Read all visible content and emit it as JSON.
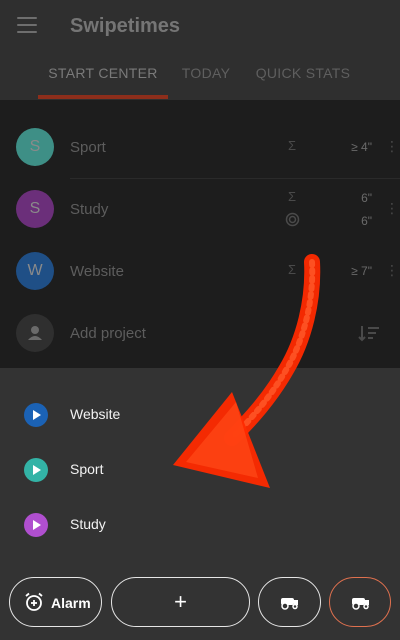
{
  "app": {
    "title": "Swipetimes"
  },
  "tabs": [
    {
      "label": "START CENTER",
      "active": true
    },
    {
      "label": "TODAY",
      "active": false
    },
    {
      "label": "QUICK STATS",
      "active": false
    }
  ],
  "projects": [
    {
      "letter": "S",
      "name": "Sport",
      "color": "#3e8f86",
      "sum_symbol": "Σ",
      "value": "≥ 4\""
    },
    {
      "letter": "S",
      "name": "Study",
      "color": "#6b2f7a",
      "sum_symbol": "Σ",
      "value": "6\"",
      "target_value": "6\""
    },
    {
      "letter": "W",
      "name": "Website",
      "color": "#1f4f86",
      "sum_symbol": "Σ",
      "value": "≥ 7\""
    }
  ],
  "add_project": {
    "label": "Add project"
  },
  "quick_start": [
    {
      "name": "Website",
      "color": "#1b62b5"
    },
    {
      "name": "Sport",
      "color": "#33b3a6"
    },
    {
      "name": "Study",
      "color": "#b04fcf"
    }
  ],
  "buttons": {
    "alarm_label": "Alarm",
    "add_symbol": "+"
  },
  "colors": {
    "accent": "#e0714f",
    "arrow": "#ff2a00"
  }
}
